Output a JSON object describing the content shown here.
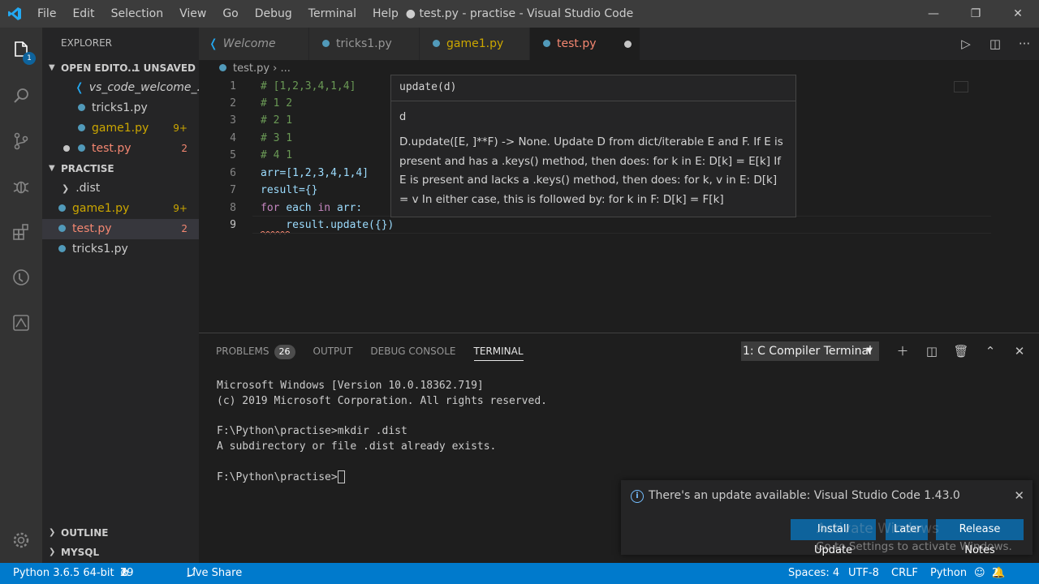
{
  "window": {
    "title": "● test.py - practise - Visual Studio Code",
    "menu": [
      "File",
      "Edit",
      "Selection",
      "View",
      "Go",
      "Debug",
      "Terminal",
      "Help"
    ]
  },
  "activity": {
    "explorer_badge": "1"
  },
  "sidebar": {
    "title": "EXPLORER",
    "open_editors": {
      "label": "OPEN EDITO...",
      "unsaved": "1 UNSAVED",
      "items": [
        {
          "label": "vs_code_welcome_...",
          "count": ""
        },
        {
          "label": "tricks1.py",
          "count": ""
        },
        {
          "label": "game1.py",
          "count": "9+"
        },
        {
          "label": "test.py",
          "count": "2"
        }
      ]
    },
    "folder": {
      "label": "PRACTISE",
      "items": [
        {
          "label": ".dist",
          "count": ""
        },
        {
          "label": "game1.py",
          "count": "9+"
        },
        {
          "label": "test.py",
          "count": "2"
        },
        {
          "label": "tricks1.py",
          "count": ""
        }
      ]
    },
    "outline": "OUTLINE",
    "mysql": "MYSQL"
  },
  "tabs": [
    {
      "label": "Welcome"
    },
    {
      "label": "tricks1.py"
    },
    {
      "label": "game1.py"
    },
    {
      "label": "test.py"
    }
  ],
  "breadcrumb": "test.py  ›  ...",
  "editor": {
    "lines": [
      {
        "n": "1",
        "text": "# [1,2,3,4,1,4]"
      },
      {
        "n": "2",
        "text": "# 1 2"
      },
      {
        "n": "3",
        "text": "# 2 1"
      },
      {
        "n": "4",
        "text": "# 3 1"
      },
      {
        "n": "5",
        "text": "# 4 1"
      },
      {
        "n": "6",
        "text": "arr=[1,2,3,4,1,4]"
      },
      {
        "n": "7",
        "text": "result={}"
      },
      {
        "n": "8",
        "kw": "for",
        "a": "each",
        "kw2": "in",
        "b": "arr:"
      },
      {
        "n": "9",
        "text": "    result.update({})"
      }
    ]
  },
  "hover": {
    "signature": "update(d)",
    "param": "d",
    "doc": "D.update([E, ]**F) -> None. Update D from dict/iterable E and F. If E is present and has a .keys() method, then does: for k in E: D[k] = E[k] If E is present and lacks a .keys() method, then does: for k, v in E: D[k] = v In either case, this is followed by: for k in F: D[k] = F[k]"
  },
  "panel": {
    "tabs": [
      "PROBLEMS",
      "OUTPUT",
      "DEBUG CONSOLE",
      "TERMINAL"
    ],
    "problems_count": "26",
    "terminal_select": "1: C Compiler Terminal",
    "terminal_lines": [
      "Microsoft Windows [Version 10.0.18362.719]",
      "(c) 2019 Microsoft Corporation. All rights reserved.",
      "",
      "F:\\Python\\practise>mkdir .dist",
      "A subdirectory or file .dist already exists.",
      "",
      "F:\\Python\\practise>"
    ]
  },
  "notification": {
    "message": "There's an update available: Visual Studio Code 1.43.0",
    "install": "Install Update",
    "later": "Later",
    "notes": "Release Notes",
    "watermark_title": "Activate Windows",
    "watermark": "Go to Settings to activate Windows."
  },
  "status": {
    "python": "Python 3.6.5 64-bit",
    "errors": "19",
    "warnings": "7",
    "liveshare": "Live Share",
    "spaces": "Spaces: 4",
    "encoding": "UTF-8",
    "eol": "CRLF",
    "language": "Python",
    "bell_count": "2"
  }
}
